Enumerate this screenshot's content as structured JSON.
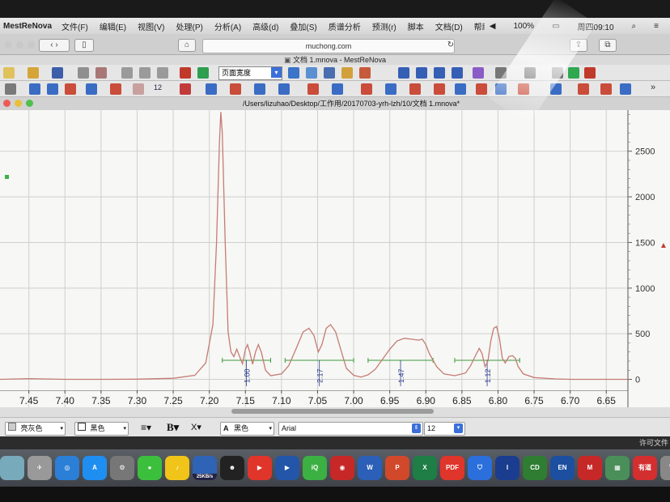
{
  "menubar": {
    "app": "MestReNova",
    "items": [
      "文件(F)",
      "编辑(E)",
      "视图(V)",
      "处理(P)",
      "分析(A)",
      "高级(d)",
      "叠加(S)",
      "质谱分析",
      "预测(r)",
      "脚本",
      "文档(D)",
      "帮助(H)"
    ],
    "battery": "100%",
    "clock": "周四09:10"
  },
  "browser": {
    "url": "muchong.com"
  },
  "window_title": "文档 1.mnova - MestReNova",
  "toolbar": {
    "zoom_value": "页面宽度",
    "num_label": "12"
  },
  "document_path": "/Users/lizuhao/Desktop/工作用/20170703-yrh-lzh/10/文档 1.mnova*",
  "format_bar": {
    "color1": "亮灰色",
    "color2": "黑色",
    "bold": "B",
    "italic_x": "X",
    "font_color_label": "A",
    "font_color": "黑色",
    "font": "Arial",
    "size": "12"
  },
  "status_right": "许可文件",
  "dock_badge": "25KB/s",
  "dock_labels": [
    "PDF",
    "CD",
    "EN",
    "有道"
  ],
  "chart_data": {
    "type": "line",
    "x_axis": {
      "reversed": true,
      "range": [
        7.49,
        6.62
      ],
      "ticks": [
        "7.45",
        "7.40",
        "7.35",
        "7.30",
        "7.25",
        "7.20",
        "7.15",
        "7.10",
        "7.05",
        "7.00",
        "6.95",
        "6.90",
        "6.85",
        "6.80",
        "6.75",
        "6.70",
        "6.65"
      ],
      "tick_values": [
        7.45,
        7.4,
        7.35,
        7.3,
        7.25,
        7.2,
        7.15,
        7.1,
        7.05,
        7.0,
        6.95,
        6.9,
        6.85,
        6.8,
        6.75,
        6.7,
        6.65
      ]
    },
    "y_axis": {
      "range": [
        -350,
        2950
      ],
      "ticks": [
        "2500",
        "2000",
        "1500",
        "1000",
        "500",
        "0"
      ],
      "tick_values": [
        2500,
        2000,
        1500,
        1000,
        500,
        0
      ],
      "position": "right"
    },
    "grid": true,
    "spectrum": [
      [
        7.49,
        0
      ],
      [
        7.45,
        8
      ],
      [
        7.4,
        0
      ],
      [
        7.35,
        0
      ],
      [
        7.3,
        2
      ],
      [
        7.25,
        12
      ],
      [
        7.22,
        45
      ],
      [
        7.205,
        180
      ],
      [
        7.195,
        600
      ],
      [
        7.19,
        1500
      ],
      [
        7.186,
        2600
      ],
      [
        7.184,
        2930
      ],
      [
        7.182,
        2700
      ],
      [
        7.178,
        1500
      ],
      [
        7.174,
        520
      ],
      [
        7.17,
        300
      ],
      [
        7.166,
        250
      ],
      [
        7.162,
        330
      ],
      [
        7.158,
        250
      ],
      [
        7.154,
        170
      ],
      [
        7.15,
        330
      ],
      [
        7.147,
        380
      ],
      [
        7.144,
        300
      ],
      [
        7.14,
        165
      ],
      [
        7.136,
        300
      ],
      [
        7.132,
        380
      ],
      [
        7.128,
        300
      ],
      [
        7.122,
        100
      ],
      [
        7.115,
        40
      ],
      [
        7.1,
        60
      ],
      [
        7.09,
        150
      ],
      [
        7.08,
        330
      ],
      [
        7.07,
        520
      ],
      [
        7.062,
        560
      ],
      [
        7.055,
        480
      ],
      [
        7.049,
        300
      ],
      [
        7.044,
        380
      ],
      [
        7.038,
        560
      ],
      [
        7.032,
        600
      ],
      [
        7.025,
        520
      ],
      [
        7.018,
        330
      ],
      [
        7.01,
        120
      ],
      [
        7.0,
        45
      ],
      [
        6.99,
        25
      ],
      [
        6.98,
        50
      ],
      [
        6.97,
        110
      ],
      [
        6.96,
        220
      ],
      [
        6.95,
        330
      ],
      [
        6.94,
        420
      ],
      [
        6.93,
        450
      ],
      [
        6.92,
        440
      ],
      [
        6.91,
        430
      ],
      [
        6.905,
        440
      ],
      [
        6.9,
        380
      ],
      [
        6.895,
        280
      ],
      [
        6.885,
        140
      ],
      [
        6.875,
        60
      ],
      [
        6.86,
        40
      ],
      [
        6.845,
        70
      ],
      [
        6.838,
        150
      ],
      [
        6.83,
        280
      ],
      [
        6.826,
        340
      ],
      [
        6.822,
        280
      ],
      [
        6.818,
        140
      ],
      [
        6.814,
        200
      ],
      [
        6.81,
        420
      ],
      [
        6.806,
        560
      ],
      [
        6.802,
        580
      ],
      [
        6.798,
        450
      ],
      [
        6.794,
        230
      ],
      [
        6.79,
        180
      ],
      [
        6.785,
        250
      ],
      [
        6.78,
        260
      ],
      [
        6.776,
        230
      ],
      [
        6.772,
        140
      ],
      [
        6.765,
        60
      ],
      [
        6.75,
        20
      ],
      [
        6.72,
        5
      ],
      [
        6.7,
        0
      ],
      [
        6.62,
        0
      ]
    ],
    "integrals": [
      {
        "label": "1.00",
        "from": 7.182,
        "to": 7.115
      },
      {
        "label": "2.17",
        "from": 7.095,
        "to": 7.0
      },
      {
        "label": "1.47",
        "from": 6.98,
        "to": 6.89
      },
      {
        "label": "1.12",
        "from": 6.86,
        "to": 6.77
      }
    ],
    "colors": {
      "spectrum": "#c47c72",
      "integral": "#3c9a3c",
      "integral_label": "#2a3f8f",
      "grid": "#cfcfcf"
    }
  }
}
